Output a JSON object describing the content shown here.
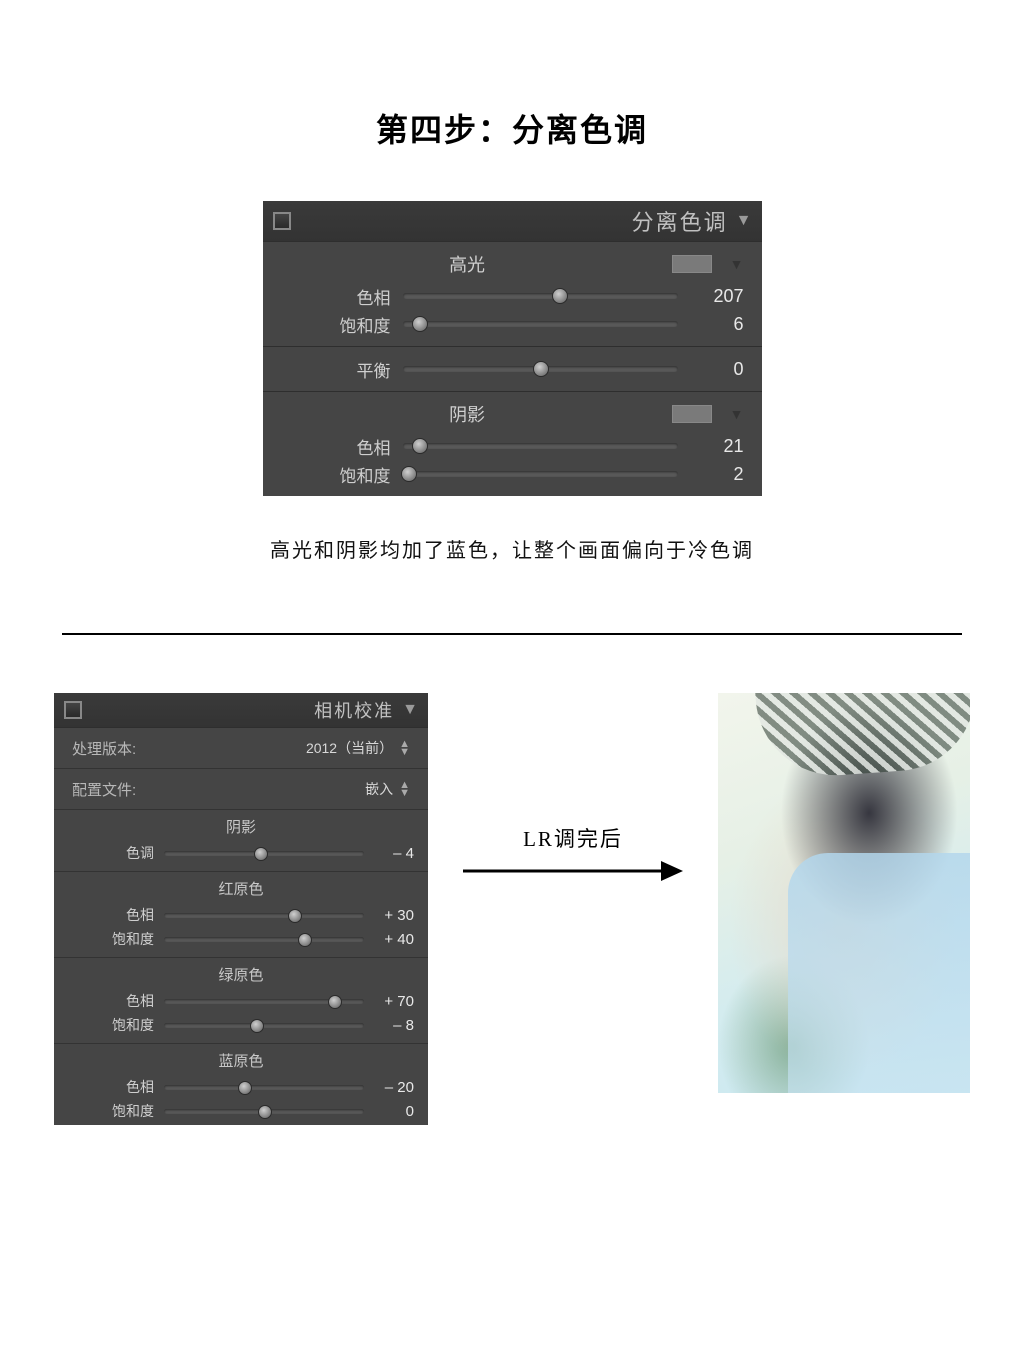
{
  "title": "第四步：分离色调",
  "split_tone": {
    "panel_title": "分离色调",
    "highlights": {
      "label": "高光",
      "hue_label": "色相",
      "hue_value": "207",
      "hue_pct": 57,
      "sat_label": "饱和度",
      "sat_value": "6",
      "sat_pct": 6
    },
    "balance": {
      "label": "平衡",
      "value": "0",
      "pct": 50
    },
    "shadows": {
      "label": "阴影",
      "hue_label": "色相",
      "hue_value": "21",
      "hue_pct": 6,
      "sat_label": "饱和度",
      "sat_value": "2",
      "sat_pct": 2
    }
  },
  "caption": "高光和阴影均加了蓝色，让整个画面偏向于冷色调",
  "calibration": {
    "panel_title": "相机校准",
    "process_label": "处理版本:",
    "process_value": "2012（当前）",
    "profile_label": "配置文件:",
    "profile_value": "嵌入",
    "shadows": {
      "label": "阴影",
      "tint_label": "色调",
      "tint_value": "– 4",
      "tint_pct": 48
    },
    "red": {
      "label": "红原色",
      "hue_label": "色相",
      "hue_value": "+ 30",
      "hue_pct": 65,
      "sat_label": "饱和度",
      "sat_value": "+ 40",
      "sat_pct": 70
    },
    "green": {
      "label": "绿原色",
      "hue_label": "色相",
      "hue_value": "+ 70",
      "hue_pct": 85,
      "sat_label": "饱和度",
      "sat_value": "– 8",
      "sat_pct": 46
    },
    "blue": {
      "label": "蓝原色",
      "hue_label": "色相",
      "hue_value": "– 20",
      "hue_pct": 40,
      "sat_label": "饱和度",
      "sat_value": "0",
      "sat_pct": 50
    }
  },
  "arrow_label": "LR调完后"
}
